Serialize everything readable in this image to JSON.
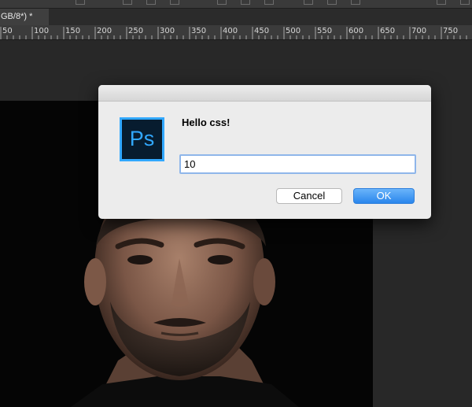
{
  "document_tab": {
    "title": "GB/8*) *"
  },
  "ruler": {
    "labels": [
      "50",
      "100",
      "150",
      "200",
      "250",
      "300",
      "350",
      "400",
      "450",
      "500",
      "550",
      "600",
      "650",
      "700",
      "750"
    ]
  },
  "dialog": {
    "message": "Hello css!",
    "input_value": "10",
    "cancel_label": "Cancel",
    "ok_label": "OK",
    "app_icon_text": "Ps"
  },
  "colors": {
    "accent": "#31a8ff",
    "ok_button": "#2a86ec",
    "input_focus": "#8fb6ea"
  }
}
